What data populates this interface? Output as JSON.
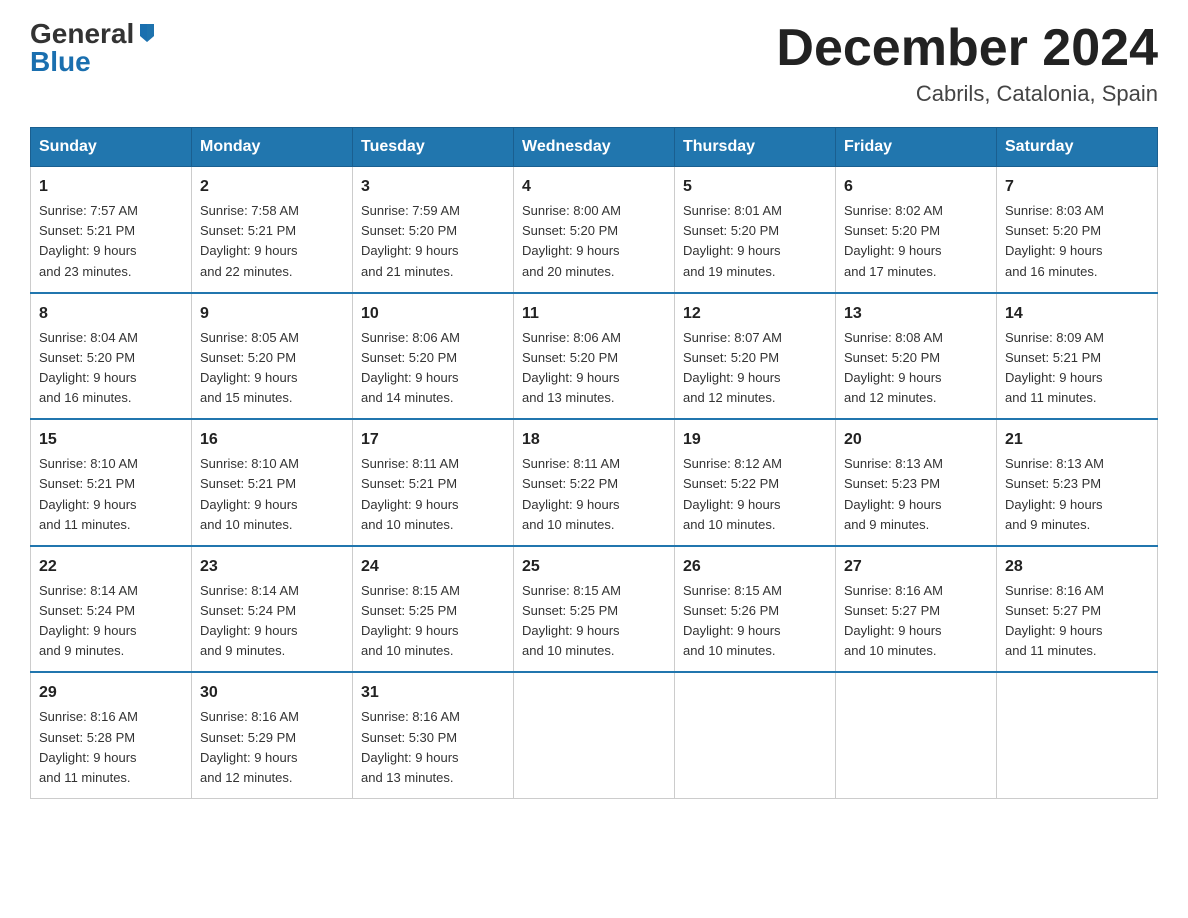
{
  "logo": {
    "general": "General",
    "blue": "Blue"
  },
  "title": "December 2024",
  "subtitle": "Cabrils, Catalonia, Spain",
  "weekdays": [
    "Sunday",
    "Monday",
    "Tuesday",
    "Wednesday",
    "Thursday",
    "Friday",
    "Saturday"
  ],
  "weeks": [
    [
      {
        "day": "1",
        "info": "Sunrise: 7:57 AM\nSunset: 5:21 PM\nDaylight: 9 hours\nand 23 minutes."
      },
      {
        "day": "2",
        "info": "Sunrise: 7:58 AM\nSunset: 5:21 PM\nDaylight: 9 hours\nand 22 minutes."
      },
      {
        "day": "3",
        "info": "Sunrise: 7:59 AM\nSunset: 5:20 PM\nDaylight: 9 hours\nand 21 minutes."
      },
      {
        "day": "4",
        "info": "Sunrise: 8:00 AM\nSunset: 5:20 PM\nDaylight: 9 hours\nand 20 minutes."
      },
      {
        "day": "5",
        "info": "Sunrise: 8:01 AM\nSunset: 5:20 PM\nDaylight: 9 hours\nand 19 minutes."
      },
      {
        "day": "6",
        "info": "Sunrise: 8:02 AM\nSunset: 5:20 PM\nDaylight: 9 hours\nand 17 minutes."
      },
      {
        "day": "7",
        "info": "Sunrise: 8:03 AM\nSunset: 5:20 PM\nDaylight: 9 hours\nand 16 minutes."
      }
    ],
    [
      {
        "day": "8",
        "info": "Sunrise: 8:04 AM\nSunset: 5:20 PM\nDaylight: 9 hours\nand 16 minutes."
      },
      {
        "day": "9",
        "info": "Sunrise: 8:05 AM\nSunset: 5:20 PM\nDaylight: 9 hours\nand 15 minutes."
      },
      {
        "day": "10",
        "info": "Sunrise: 8:06 AM\nSunset: 5:20 PM\nDaylight: 9 hours\nand 14 minutes."
      },
      {
        "day": "11",
        "info": "Sunrise: 8:06 AM\nSunset: 5:20 PM\nDaylight: 9 hours\nand 13 minutes."
      },
      {
        "day": "12",
        "info": "Sunrise: 8:07 AM\nSunset: 5:20 PM\nDaylight: 9 hours\nand 12 minutes."
      },
      {
        "day": "13",
        "info": "Sunrise: 8:08 AM\nSunset: 5:20 PM\nDaylight: 9 hours\nand 12 minutes."
      },
      {
        "day": "14",
        "info": "Sunrise: 8:09 AM\nSunset: 5:21 PM\nDaylight: 9 hours\nand 11 minutes."
      }
    ],
    [
      {
        "day": "15",
        "info": "Sunrise: 8:10 AM\nSunset: 5:21 PM\nDaylight: 9 hours\nand 11 minutes."
      },
      {
        "day": "16",
        "info": "Sunrise: 8:10 AM\nSunset: 5:21 PM\nDaylight: 9 hours\nand 10 minutes."
      },
      {
        "day": "17",
        "info": "Sunrise: 8:11 AM\nSunset: 5:21 PM\nDaylight: 9 hours\nand 10 minutes."
      },
      {
        "day": "18",
        "info": "Sunrise: 8:11 AM\nSunset: 5:22 PM\nDaylight: 9 hours\nand 10 minutes."
      },
      {
        "day": "19",
        "info": "Sunrise: 8:12 AM\nSunset: 5:22 PM\nDaylight: 9 hours\nand 10 minutes."
      },
      {
        "day": "20",
        "info": "Sunrise: 8:13 AM\nSunset: 5:23 PM\nDaylight: 9 hours\nand 9 minutes."
      },
      {
        "day": "21",
        "info": "Sunrise: 8:13 AM\nSunset: 5:23 PM\nDaylight: 9 hours\nand 9 minutes."
      }
    ],
    [
      {
        "day": "22",
        "info": "Sunrise: 8:14 AM\nSunset: 5:24 PM\nDaylight: 9 hours\nand 9 minutes."
      },
      {
        "day": "23",
        "info": "Sunrise: 8:14 AM\nSunset: 5:24 PM\nDaylight: 9 hours\nand 9 minutes."
      },
      {
        "day": "24",
        "info": "Sunrise: 8:15 AM\nSunset: 5:25 PM\nDaylight: 9 hours\nand 10 minutes."
      },
      {
        "day": "25",
        "info": "Sunrise: 8:15 AM\nSunset: 5:25 PM\nDaylight: 9 hours\nand 10 minutes."
      },
      {
        "day": "26",
        "info": "Sunrise: 8:15 AM\nSunset: 5:26 PM\nDaylight: 9 hours\nand 10 minutes."
      },
      {
        "day": "27",
        "info": "Sunrise: 8:16 AM\nSunset: 5:27 PM\nDaylight: 9 hours\nand 10 minutes."
      },
      {
        "day": "28",
        "info": "Sunrise: 8:16 AM\nSunset: 5:27 PM\nDaylight: 9 hours\nand 11 minutes."
      }
    ],
    [
      {
        "day": "29",
        "info": "Sunrise: 8:16 AM\nSunset: 5:28 PM\nDaylight: 9 hours\nand 11 minutes."
      },
      {
        "day": "30",
        "info": "Sunrise: 8:16 AM\nSunset: 5:29 PM\nDaylight: 9 hours\nand 12 minutes."
      },
      {
        "day": "31",
        "info": "Sunrise: 8:16 AM\nSunset: 5:30 PM\nDaylight: 9 hours\nand 13 minutes."
      },
      {
        "day": "",
        "info": ""
      },
      {
        "day": "",
        "info": ""
      },
      {
        "day": "",
        "info": ""
      },
      {
        "day": "",
        "info": ""
      }
    ]
  ]
}
